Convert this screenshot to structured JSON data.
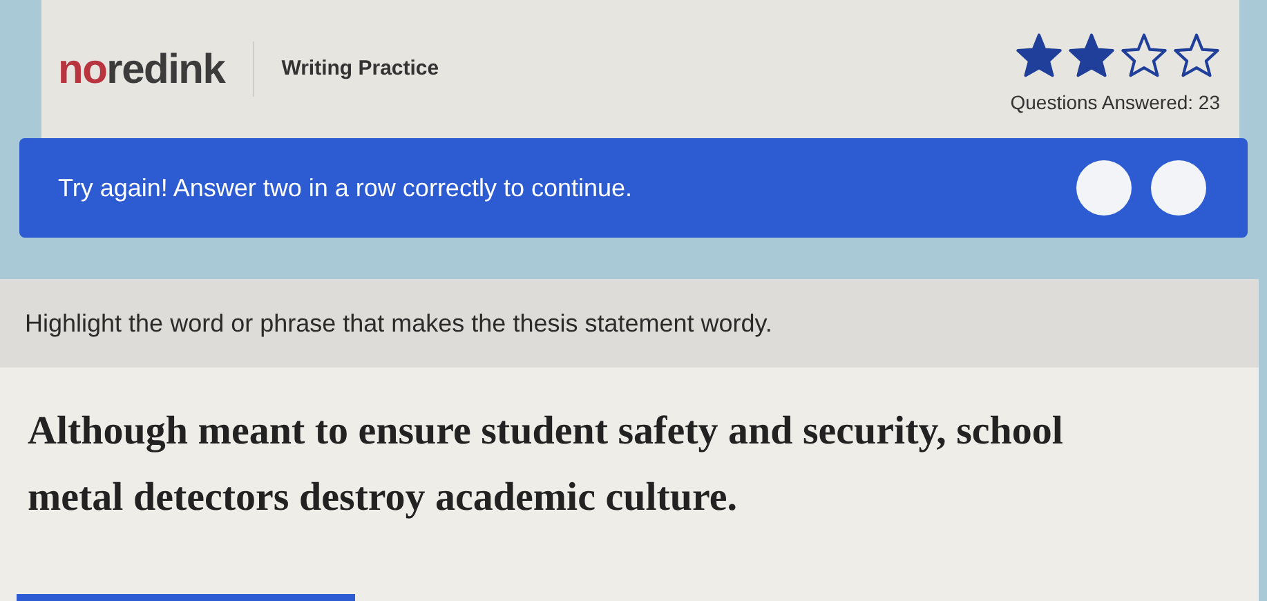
{
  "header": {
    "logo": [
      {
        "text": "no",
        "color": "#b8343f"
      },
      {
        "text": "redink",
        "color": "#3c3c3c"
      }
    ],
    "subtitle": "Writing Practice",
    "stars": 2,
    "questions_answered": "Questions Answered: 23"
  },
  "banner": {
    "message": "Try again! Answer two in a row correctly to continue.",
    "progress_dots": [
      {
        "filled": false
      },
      {
        "filled": false
      }
    ]
  },
  "question": {
    "prompt": "Highlight the word or phrase that makes the thesis statement wordy.",
    "sentence": "Although meant to ensure student safety and security, school metal detectors destroy academic culture."
  }
}
